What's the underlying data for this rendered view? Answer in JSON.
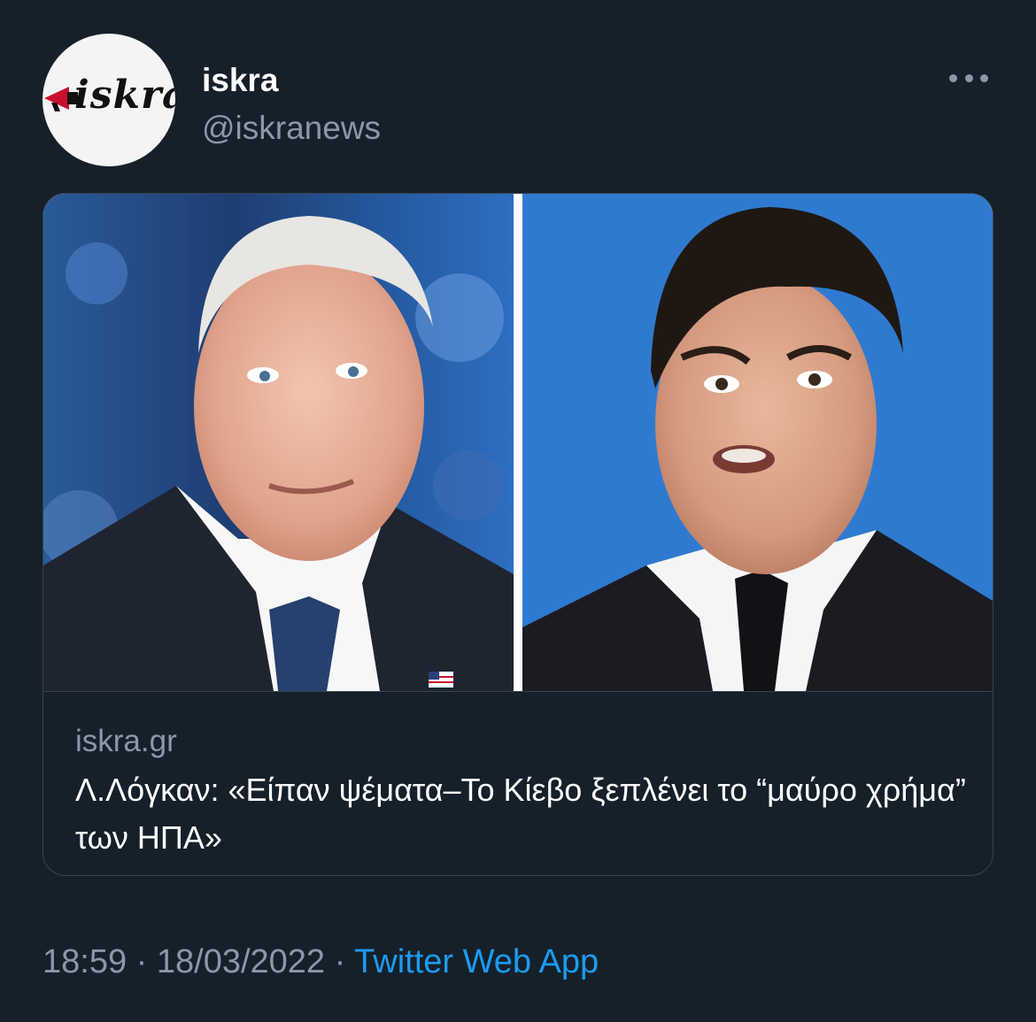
{
  "tweet": {
    "author_name": "iskra",
    "author_handle": "@iskranews",
    "avatar_logo_text": "iskra",
    "more_icon": "more-horizontal-icon",
    "time": "18:59",
    "date": "18/03/2022",
    "source": "Twitter Web App",
    "separator": "·"
  },
  "link_card": {
    "domain": "iskra.gr",
    "title": "Λ.Λόγκαν: «Είπαν ψέματα–Το Κίεβο ξεπλένει το “μαύρο χρήμα” των ΗΠΑ»"
  },
  "colors": {
    "background": "#15202b",
    "border": "#38444d",
    "secondary_text": "#8b98a5",
    "link": "#1d9bf0"
  }
}
